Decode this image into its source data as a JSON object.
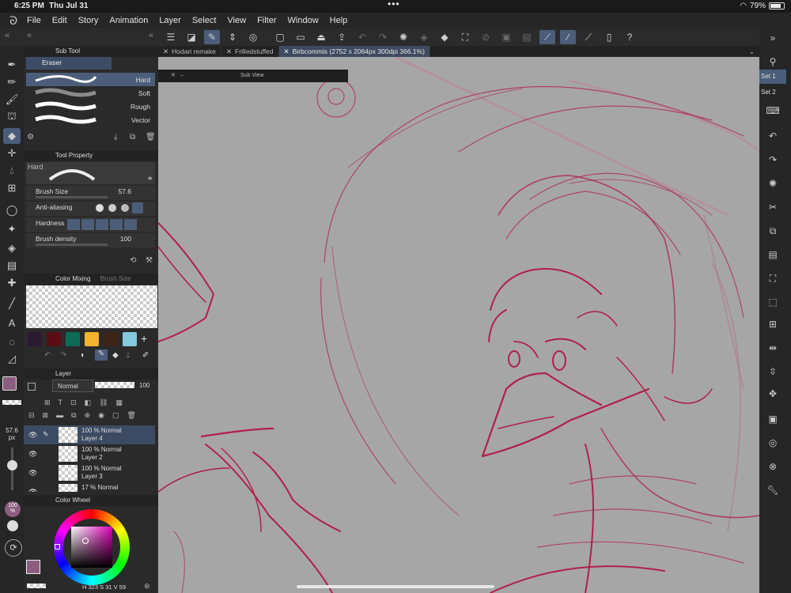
{
  "status": {
    "time": "6:25 PM",
    "date": "Thu Jul 31",
    "battery": "79%",
    "battery_level": 0.79
  },
  "menu": [
    "File",
    "Edit",
    "Story",
    "Animation",
    "Layer",
    "Select",
    "View",
    "Filter",
    "Window",
    "Help"
  ],
  "tabs": [
    {
      "label": "Hodari remake",
      "active": false
    },
    {
      "label": "Frilledstuffed",
      "active": false
    },
    {
      "label": "Birbcommis (2752 x 2064px 300dpi 366.1%)",
      "active": true
    }
  ],
  "subview": {
    "title": "Sub View"
  },
  "subtool": {
    "header": "Sub Tool",
    "group": "Eraser",
    "brushes": [
      {
        "label": "Hard",
        "selected": true
      },
      {
        "label": "Soft",
        "selected": false
      },
      {
        "label": "Rough",
        "selected": false
      },
      {
        "label": "Vector",
        "selected": false
      }
    ]
  },
  "tool_property": {
    "header": "Tool Property",
    "preset": "Hard",
    "brush_size_label": "Brush Size",
    "brush_size_value": "57.6",
    "antialias_label": "Anti-aliasing",
    "hardness_label": "Hardness",
    "density_label": "Brush density",
    "density_value": "100"
  },
  "color_mixing": {
    "header": "Color Mixing",
    "tab2": "Brush Size"
  },
  "swatch_colors": [
    "#2a1a33",
    "#5a0d14",
    "#0c6b55",
    "#f2b431",
    "#3d2418",
    "#86c9de"
  ],
  "layer_panel": {
    "header": "Layer",
    "blend_mode": "Normal",
    "opacity": "100",
    "layers": [
      {
        "line1": "100 %  Normal",
        "line2": "Layer 4",
        "selected": true
      },
      {
        "line1": "100 %  Normal",
        "line2": "Layer 2",
        "selected": false
      },
      {
        "line1": "100 %  Normal",
        "line2": "Layer 3",
        "selected": false
      },
      {
        "line1": "17 %  Normal",
        "line2": "",
        "selected": false
      }
    ]
  },
  "color_wheel": {
    "header": "Color Wheel",
    "h": "323",
    "s": "31",
    "v": "59",
    "h_label": "H",
    "s_label": "S",
    "v_label": "V"
  },
  "size_readout": {
    "value": "57.6",
    "unit": "px"
  },
  "opacity_readout": {
    "value": "100",
    "unit": "%"
  },
  "colors": {
    "main": "#8c5d7e",
    "sub": "#ffffff",
    "stroke": "#b0204a",
    "accent": "#4b5d79"
  },
  "right_sets": [
    "Set 1",
    "Set 2"
  ]
}
